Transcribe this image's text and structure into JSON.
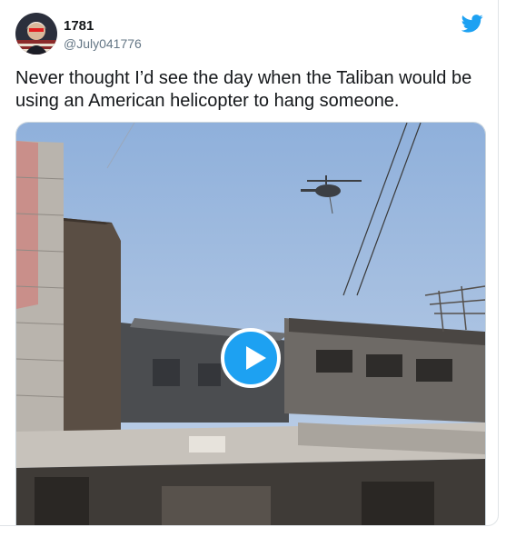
{
  "tweet": {
    "display_name": "1781",
    "handle": "@July041776",
    "text": "Never thought I’d see the day when the Taliban would be using an American helicopter to hang someone."
  },
  "icons": {
    "brand": "twitter-bird-icon",
    "play": "play-icon"
  },
  "colors": {
    "accent": "#1da1f2",
    "text": "#14171a",
    "muted": "#657786"
  }
}
